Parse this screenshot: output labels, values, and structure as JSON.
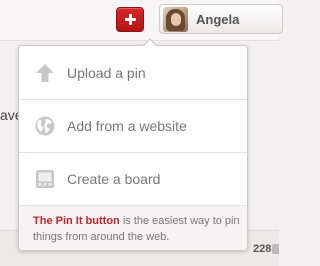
{
  "header": {
    "add_button": {
      "icon": "plus-icon"
    },
    "user": {
      "name": "Angela",
      "avatar": "avatar"
    }
  },
  "background": {
    "left_fragment": "ave",
    "count": "228"
  },
  "add_menu": {
    "items": [
      {
        "label": "Upload a pin",
        "icon": "upload-arrow-icon"
      },
      {
        "label": "Add from a website",
        "icon": "globe-icon"
      },
      {
        "label": "Create a board",
        "icon": "board-icon"
      }
    ],
    "promo": {
      "link_text": "The Pin It button",
      "text": " is the easiest way to pin things from around the web."
    }
  },
  "colors": {
    "brand_red": "#c8232c",
    "icon_gray": "#c7c7c7",
    "text_gray": "#777777"
  }
}
